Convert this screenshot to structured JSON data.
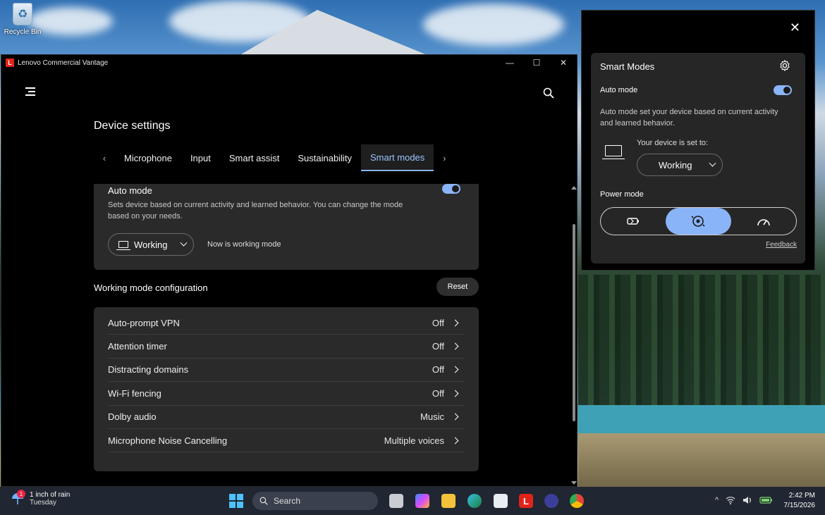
{
  "desktop": {
    "recycle_bin_label": "Recycle Bin"
  },
  "window": {
    "title": "Lenovo Commercial Vantage",
    "minimize_glyph": "—",
    "maximize_glyph": "☐",
    "close_glyph": "✕"
  },
  "page": {
    "title": "Device settings"
  },
  "tabs": {
    "prev_glyph": "‹",
    "next_glyph": "›",
    "items": [
      "Microphone",
      "Input",
      "Smart assist",
      "Sustainability",
      "Smart modes"
    ],
    "active": "Smart modes"
  },
  "auto_mode": {
    "title": "Auto mode",
    "description": "Sets device based on current activity and learned behavior. You can change the mode based on your needs.",
    "enabled": true,
    "selected_mode": "Working",
    "status_text": "Now is working mode"
  },
  "working_config": {
    "title": "Working mode configuration",
    "reset_label": "Reset",
    "rows": [
      {
        "label": "Auto-prompt VPN",
        "value": "Off"
      },
      {
        "label": "Attention timer",
        "value": "Off"
      },
      {
        "label": "Distracting domains",
        "value": "Off"
      },
      {
        "label": "Wi-Fi fencing",
        "value": "Off"
      },
      {
        "label": "Dolby audio",
        "value": "Music"
      },
      {
        "label": "Microphone Noise Cancelling",
        "value": "Multiple voices"
      }
    ]
  },
  "flyout": {
    "close_glyph": "✕",
    "title": "Smart Modes",
    "auto_label": "Auto mode",
    "auto_enabled": true,
    "description": "Auto mode set your device based on current activity and learned behavior.",
    "set_to_label": "Your device is set to:",
    "selected_mode": "Working",
    "power_label": "Power mode",
    "power_modes": [
      "battery-saver",
      "balanced",
      "performance"
    ],
    "power_active": "balanced",
    "feedback_label": "Feedback"
  },
  "taskbar": {
    "weather_badge": "1",
    "weather_line1": "1 inch of rain",
    "weather_line2": "Tuesday",
    "search_placeholder": "Search",
    "tray_chevron": "^",
    "time": "2:42 PM",
    "date": "7/15/2026"
  },
  "colors": {
    "accent": "#8ab4f8",
    "lenovo_red": "#e2231a",
    "card_bg": "#2a2a2a"
  }
}
